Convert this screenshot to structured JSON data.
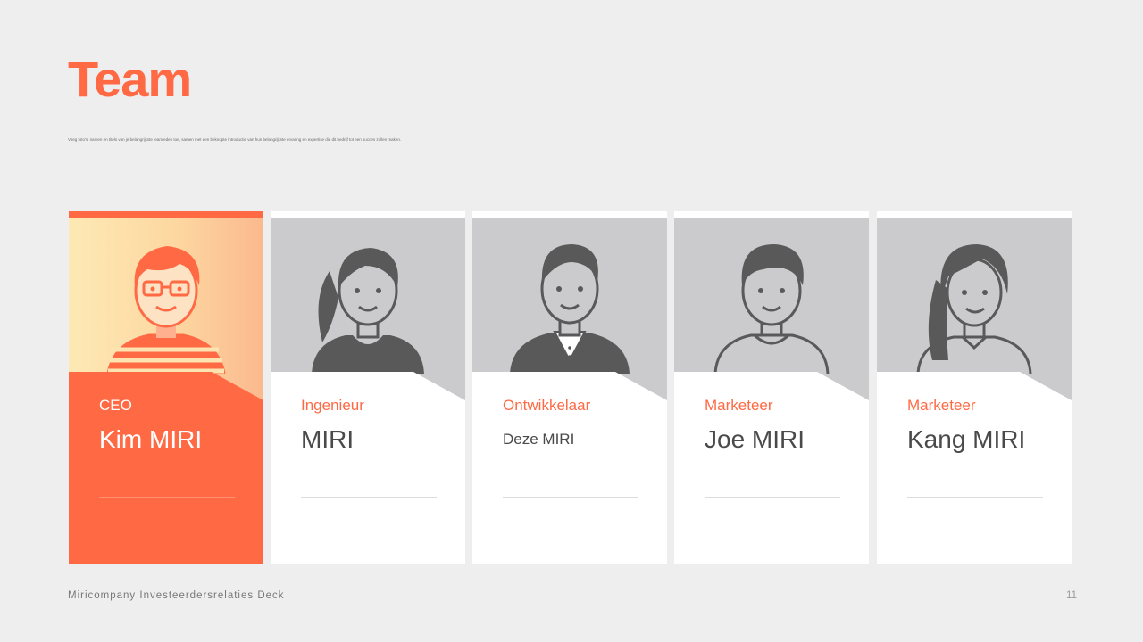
{
  "slide": {
    "title": "Team",
    "subtitle": "Voeg foto's, namen en titels van je belangrijkste teamleden toe, samen met een beknopte introductie van hun belangrijkste ervaring en expertise die dit bedrijf tot een succes zullen maken.",
    "footer": "Miricompany Investeerdersrelaties Deck",
    "page_number": "11"
  },
  "colors": {
    "accent": "#ff6a45",
    "avatar_gray": "#5a595a",
    "photo_bg": "#cbcacc"
  },
  "team": [
    {
      "role": "CEO",
      "name": "Kim MIRI",
      "avatar": "man-glasses-striped-shirt-icon",
      "active": true
    },
    {
      "role": "Ingenieur",
      "name": "MIRI",
      "avatar": "woman-ponytail-icon",
      "active": false
    },
    {
      "role": "Ontwikkelaar",
      "name": "Deze MIRI",
      "avatar": "man-suit-icon",
      "active": false
    },
    {
      "role": "Marketeer",
      "name": "Joe MIRI",
      "avatar": "man-sweater-icon",
      "active": false
    },
    {
      "role": "Marketeer",
      "name": "Kang MIRI",
      "avatar": "woman-long-hair-icon",
      "active": false
    }
  ]
}
